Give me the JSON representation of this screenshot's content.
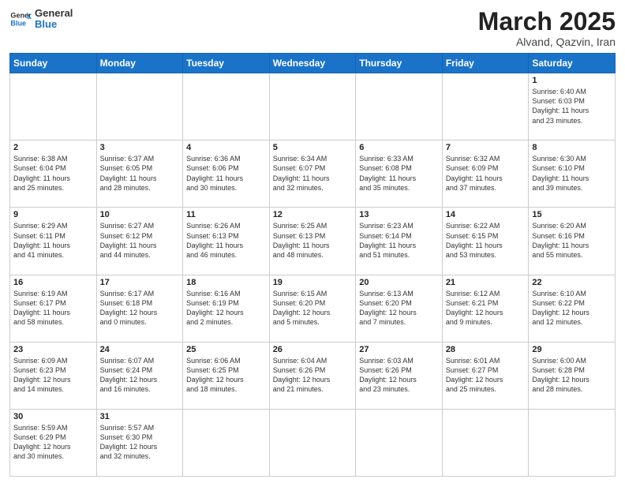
{
  "header": {
    "logo_general": "General",
    "logo_blue": "Blue",
    "month": "March 2025",
    "location": "Alvand, Qazvin, Iran"
  },
  "days_of_week": [
    "Sunday",
    "Monday",
    "Tuesday",
    "Wednesday",
    "Thursday",
    "Friday",
    "Saturday"
  ],
  "weeks": [
    [
      {
        "day": "",
        "content": ""
      },
      {
        "day": "",
        "content": ""
      },
      {
        "day": "",
        "content": ""
      },
      {
        "day": "",
        "content": ""
      },
      {
        "day": "",
        "content": ""
      },
      {
        "day": "",
        "content": ""
      },
      {
        "day": "1",
        "content": "Sunrise: 6:40 AM\nSunset: 6:03 PM\nDaylight: 11 hours\nand 23 minutes."
      }
    ],
    [
      {
        "day": "2",
        "content": "Sunrise: 6:38 AM\nSunset: 6:04 PM\nDaylight: 11 hours\nand 25 minutes."
      },
      {
        "day": "3",
        "content": "Sunrise: 6:37 AM\nSunset: 6:05 PM\nDaylight: 11 hours\nand 28 minutes."
      },
      {
        "day": "4",
        "content": "Sunrise: 6:36 AM\nSunset: 6:06 PM\nDaylight: 11 hours\nand 30 minutes."
      },
      {
        "day": "5",
        "content": "Sunrise: 6:34 AM\nSunset: 6:07 PM\nDaylight: 11 hours\nand 32 minutes."
      },
      {
        "day": "6",
        "content": "Sunrise: 6:33 AM\nSunset: 6:08 PM\nDaylight: 11 hours\nand 35 minutes."
      },
      {
        "day": "7",
        "content": "Sunrise: 6:32 AM\nSunset: 6:09 PM\nDaylight: 11 hours\nand 37 minutes."
      },
      {
        "day": "8",
        "content": "Sunrise: 6:30 AM\nSunset: 6:10 PM\nDaylight: 11 hours\nand 39 minutes."
      }
    ],
    [
      {
        "day": "9",
        "content": "Sunrise: 6:29 AM\nSunset: 6:11 PM\nDaylight: 11 hours\nand 41 minutes."
      },
      {
        "day": "10",
        "content": "Sunrise: 6:27 AM\nSunset: 6:12 PM\nDaylight: 11 hours\nand 44 minutes."
      },
      {
        "day": "11",
        "content": "Sunrise: 6:26 AM\nSunset: 6:13 PM\nDaylight: 11 hours\nand 46 minutes."
      },
      {
        "day": "12",
        "content": "Sunrise: 6:25 AM\nSunset: 6:13 PM\nDaylight: 11 hours\nand 48 minutes."
      },
      {
        "day": "13",
        "content": "Sunrise: 6:23 AM\nSunset: 6:14 PM\nDaylight: 11 hours\nand 51 minutes."
      },
      {
        "day": "14",
        "content": "Sunrise: 6:22 AM\nSunset: 6:15 PM\nDaylight: 11 hours\nand 53 minutes."
      },
      {
        "day": "15",
        "content": "Sunrise: 6:20 AM\nSunset: 6:16 PM\nDaylight: 11 hours\nand 55 minutes."
      }
    ],
    [
      {
        "day": "16",
        "content": "Sunrise: 6:19 AM\nSunset: 6:17 PM\nDaylight: 11 hours\nand 58 minutes."
      },
      {
        "day": "17",
        "content": "Sunrise: 6:17 AM\nSunset: 6:18 PM\nDaylight: 12 hours\nand 0 minutes."
      },
      {
        "day": "18",
        "content": "Sunrise: 6:16 AM\nSunset: 6:19 PM\nDaylight: 12 hours\nand 2 minutes."
      },
      {
        "day": "19",
        "content": "Sunrise: 6:15 AM\nSunset: 6:20 PM\nDaylight: 12 hours\nand 5 minutes."
      },
      {
        "day": "20",
        "content": "Sunrise: 6:13 AM\nSunset: 6:20 PM\nDaylight: 12 hours\nand 7 minutes."
      },
      {
        "day": "21",
        "content": "Sunrise: 6:12 AM\nSunset: 6:21 PM\nDaylight: 12 hours\nand 9 minutes."
      },
      {
        "day": "22",
        "content": "Sunrise: 6:10 AM\nSunset: 6:22 PM\nDaylight: 12 hours\nand 12 minutes."
      }
    ],
    [
      {
        "day": "23",
        "content": "Sunrise: 6:09 AM\nSunset: 6:23 PM\nDaylight: 12 hours\nand 14 minutes."
      },
      {
        "day": "24",
        "content": "Sunrise: 6:07 AM\nSunset: 6:24 PM\nDaylight: 12 hours\nand 16 minutes."
      },
      {
        "day": "25",
        "content": "Sunrise: 6:06 AM\nSunset: 6:25 PM\nDaylight: 12 hours\nand 18 minutes."
      },
      {
        "day": "26",
        "content": "Sunrise: 6:04 AM\nSunset: 6:26 PM\nDaylight: 12 hours\nand 21 minutes."
      },
      {
        "day": "27",
        "content": "Sunrise: 6:03 AM\nSunset: 6:26 PM\nDaylight: 12 hours\nand 23 minutes."
      },
      {
        "day": "28",
        "content": "Sunrise: 6:01 AM\nSunset: 6:27 PM\nDaylight: 12 hours\nand 25 minutes."
      },
      {
        "day": "29",
        "content": "Sunrise: 6:00 AM\nSunset: 6:28 PM\nDaylight: 12 hours\nand 28 minutes."
      }
    ],
    [
      {
        "day": "30",
        "content": "Sunrise: 5:59 AM\nSunset: 6:29 PM\nDaylight: 12 hours\nand 30 minutes."
      },
      {
        "day": "31",
        "content": "Sunrise: 5:57 AM\nSunset: 6:30 PM\nDaylight: 12 hours\nand 32 minutes."
      },
      {
        "day": "",
        "content": ""
      },
      {
        "day": "",
        "content": ""
      },
      {
        "day": "",
        "content": ""
      },
      {
        "day": "",
        "content": ""
      },
      {
        "day": "",
        "content": ""
      }
    ]
  ]
}
